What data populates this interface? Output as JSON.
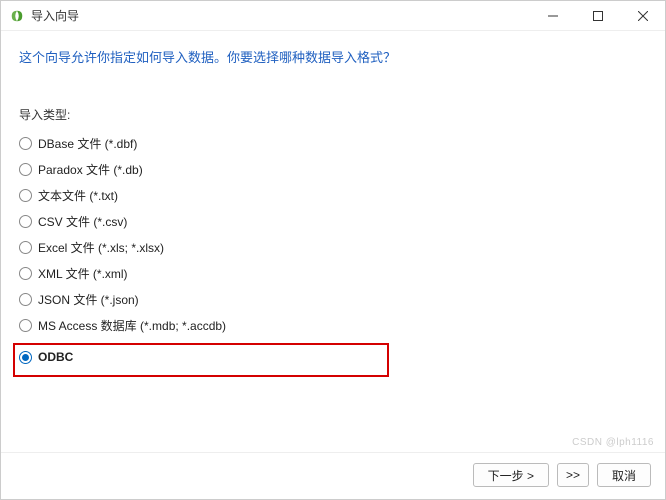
{
  "titlebar": {
    "title": "导入向导"
  },
  "instruction": "这个向导允许你指定如何导入数据。你要选择哪种数据导入格式？",
  "section_label": "导入类型:",
  "import_types": [
    {
      "label": "DBase 文件 (*.dbf)",
      "selected": false,
      "highlighted": false
    },
    {
      "label": "Paradox 文件 (*.db)",
      "selected": false,
      "highlighted": false
    },
    {
      "label": "文本文件 (*.txt)",
      "selected": false,
      "highlighted": false
    },
    {
      "label": "CSV 文件 (*.csv)",
      "selected": false,
      "highlighted": false
    },
    {
      "label": "Excel 文件 (*.xls; *.xlsx)",
      "selected": false,
      "highlighted": false
    },
    {
      "label": "XML 文件 (*.xml)",
      "selected": false,
      "highlighted": false
    },
    {
      "label": "JSON 文件 (*.json)",
      "selected": false,
      "highlighted": false
    },
    {
      "label": "MS Access 数据库 (*.mdb; *.accdb)",
      "selected": false,
      "highlighted": false
    },
    {
      "label": "ODBC",
      "selected": true,
      "highlighted": true
    }
  ],
  "footer": {
    "next": "下一步 >",
    "last": ">>",
    "cancel": "取消"
  },
  "watermark": "CSDN @lph1116"
}
